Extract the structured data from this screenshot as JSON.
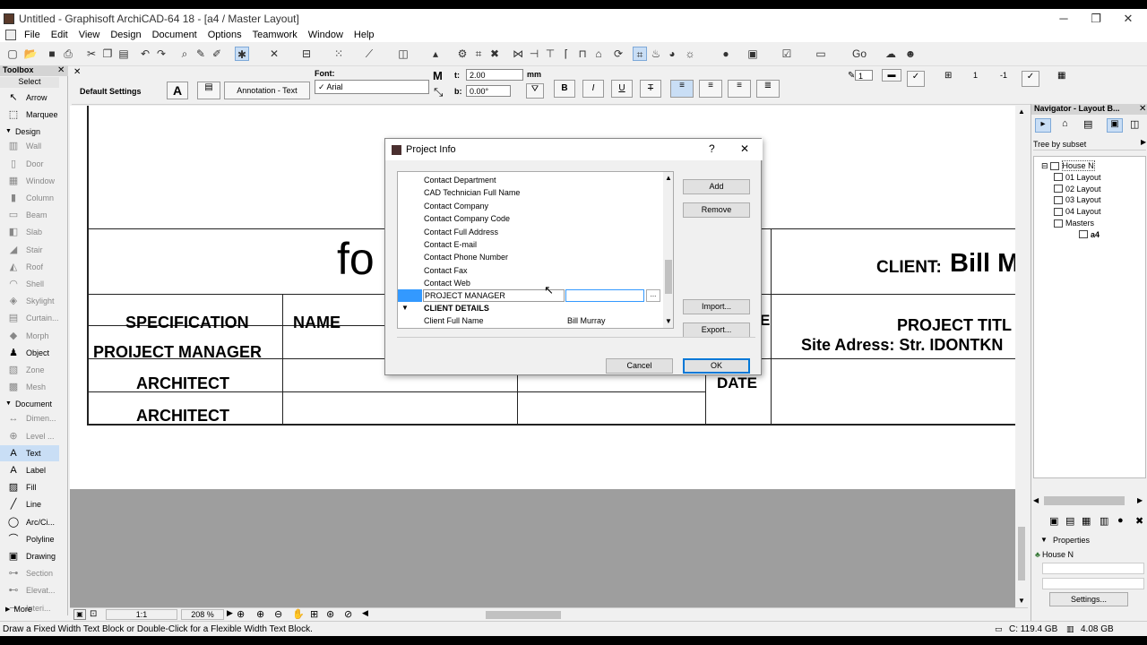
{
  "window": {
    "title": "Untitled - Graphisoft ArchiCAD-64 18 - [a4 / Master Layout]",
    "minimize": "─",
    "maximize": "❐",
    "close": "✕"
  },
  "menu": [
    "File",
    "Edit",
    "View",
    "Design",
    "Document",
    "Options",
    "Teamwork",
    "Window",
    "Help"
  ],
  "infobox": {
    "default_settings": "Default Settings",
    "text_tool_label": "A",
    "layer": "Annotation - Text",
    "font_label": "Font:",
    "font_value": "✓ Arial",
    "size_value": "2.00",
    "size_unit": "mm",
    "angle_label": "b:",
    "angle_value": "0.00°",
    "size_label": "t:",
    "bold": "B",
    "italic": "I",
    "underline": "U",
    "strike": "T",
    "right_num_1": "1",
    "right_num_2": "1",
    "right_num_3": "-1"
  },
  "toolbox": {
    "title": "Toolbox",
    "select_label": "Select",
    "sections": {
      "design": "Design",
      "document": "Document",
      "more": "More"
    },
    "items_top": [
      {
        "label": "Arrow",
        "icon": "↖"
      },
      {
        "label": "Marquee",
        "icon": "⬚"
      }
    ],
    "design_items": [
      {
        "label": "Wall",
        "icon": "▥"
      },
      {
        "label": "Door",
        "icon": "▯"
      },
      {
        "label": "Window",
        "icon": "▦"
      },
      {
        "label": "Column",
        "icon": "▮"
      },
      {
        "label": "Beam",
        "icon": "▭"
      },
      {
        "label": "Slab",
        "icon": "◧"
      },
      {
        "label": "Stair",
        "icon": "◢"
      },
      {
        "label": "Roof",
        "icon": "◭"
      },
      {
        "label": "Shell",
        "icon": "◠"
      },
      {
        "label": "Skylight",
        "icon": "◈"
      },
      {
        "label": "Curtain...",
        "icon": "▤"
      },
      {
        "label": "Morph",
        "icon": "◆"
      },
      {
        "label": "Object",
        "icon": "♟"
      },
      {
        "label": "Zone",
        "icon": "▧"
      },
      {
        "label": "Mesh",
        "icon": "▩"
      }
    ],
    "document_items": [
      {
        "label": "Dimen...",
        "icon": "↔"
      },
      {
        "label": "Level ...",
        "icon": "⊕"
      },
      {
        "label": "Text",
        "icon": "A"
      },
      {
        "label": "Label",
        "icon": "A"
      },
      {
        "label": "Fill",
        "icon": "▨"
      },
      {
        "label": "Line",
        "icon": "╱"
      },
      {
        "label": "Arc/Ci...",
        "icon": "◯"
      },
      {
        "label": "Polyline",
        "icon": "⌒"
      },
      {
        "label": "Drawing",
        "icon": "▣"
      },
      {
        "label": "Section",
        "icon": "⊶"
      },
      {
        "label": "Elevat...",
        "icon": "⊷"
      },
      {
        "label": "Interi...",
        "icon": "⊸"
      }
    ]
  },
  "canvas": {
    "big_text": "fo",
    "client_label": "CLIENT:",
    "client_name": "Bill M",
    "project_title": "PROJECT TITL",
    "site_address": "Site Adress: Str. IDONTKN",
    "date_label": "DATE",
    "e_fragment": "E",
    "rows": [
      "SPECIFICATION",
      "PROIJECT MANAGER",
      "ARCHITECT",
      "ARCHITECT"
    ],
    "name_header": "NAME"
  },
  "navigator": {
    "title": "Navigator - Layout B...",
    "tree_by": "Tree by subset",
    "tree": [
      {
        "label": "House N",
        "level": 0
      },
      {
        "label": "01 Layout",
        "level": 1
      },
      {
        "label": "02 Layout",
        "level": 1
      },
      {
        "label": "03 Layout",
        "level": 1
      },
      {
        "label": "04 Layout",
        "level": 1
      },
      {
        "label": "Masters",
        "level": 1
      },
      {
        "label": "a4",
        "level": 2
      }
    ],
    "properties_label": "Properties",
    "prop_name": "House N",
    "settings_button": "Settings..."
  },
  "dialog": {
    "title": "Project Info",
    "help": "?",
    "close": "✕",
    "rows": [
      {
        "key": "Contact Department",
        "value": ""
      },
      {
        "key": "CAD Technician Full Name",
        "value": ""
      },
      {
        "key": "Contact Company",
        "value": ""
      },
      {
        "key": "Contact Company Code",
        "value": ""
      },
      {
        "key": "Contact Full Address",
        "value": ""
      },
      {
        "key": "Contact E-mail",
        "value": ""
      },
      {
        "key": "Contact Phone Number",
        "value": ""
      },
      {
        "key": "Contact Fax",
        "value": ""
      },
      {
        "key": "Contact Web",
        "value": ""
      }
    ],
    "editing_row_key": "PROJECT MANAGER",
    "ellipsis": "...",
    "section_header": "CLIENT DETAILS",
    "client_row": {
      "key": "Client Full Name",
      "value": "Bill Murray"
    },
    "buttons": {
      "add": "Add",
      "remove": "Remove",
      "import": "Import...",
      "export": "Export...",
      "cancel": "Cancel",
      "ok": "OK"
    }
  },
  "bottom": {
    "scale": "1:1",
    "zoom": "208 %"
  },
  "status": {
    "hint": "Draw a Fixed Width Text Block or Double-Click for a Flexible Width Text Block.",
    "disk": "C: 119.4 GB",
    "ram": "4.08 GB"
  },
  "colors": {
    "selection_blue": "#c9def5",
    "row_highlight": "#3399ff"
  }
}
